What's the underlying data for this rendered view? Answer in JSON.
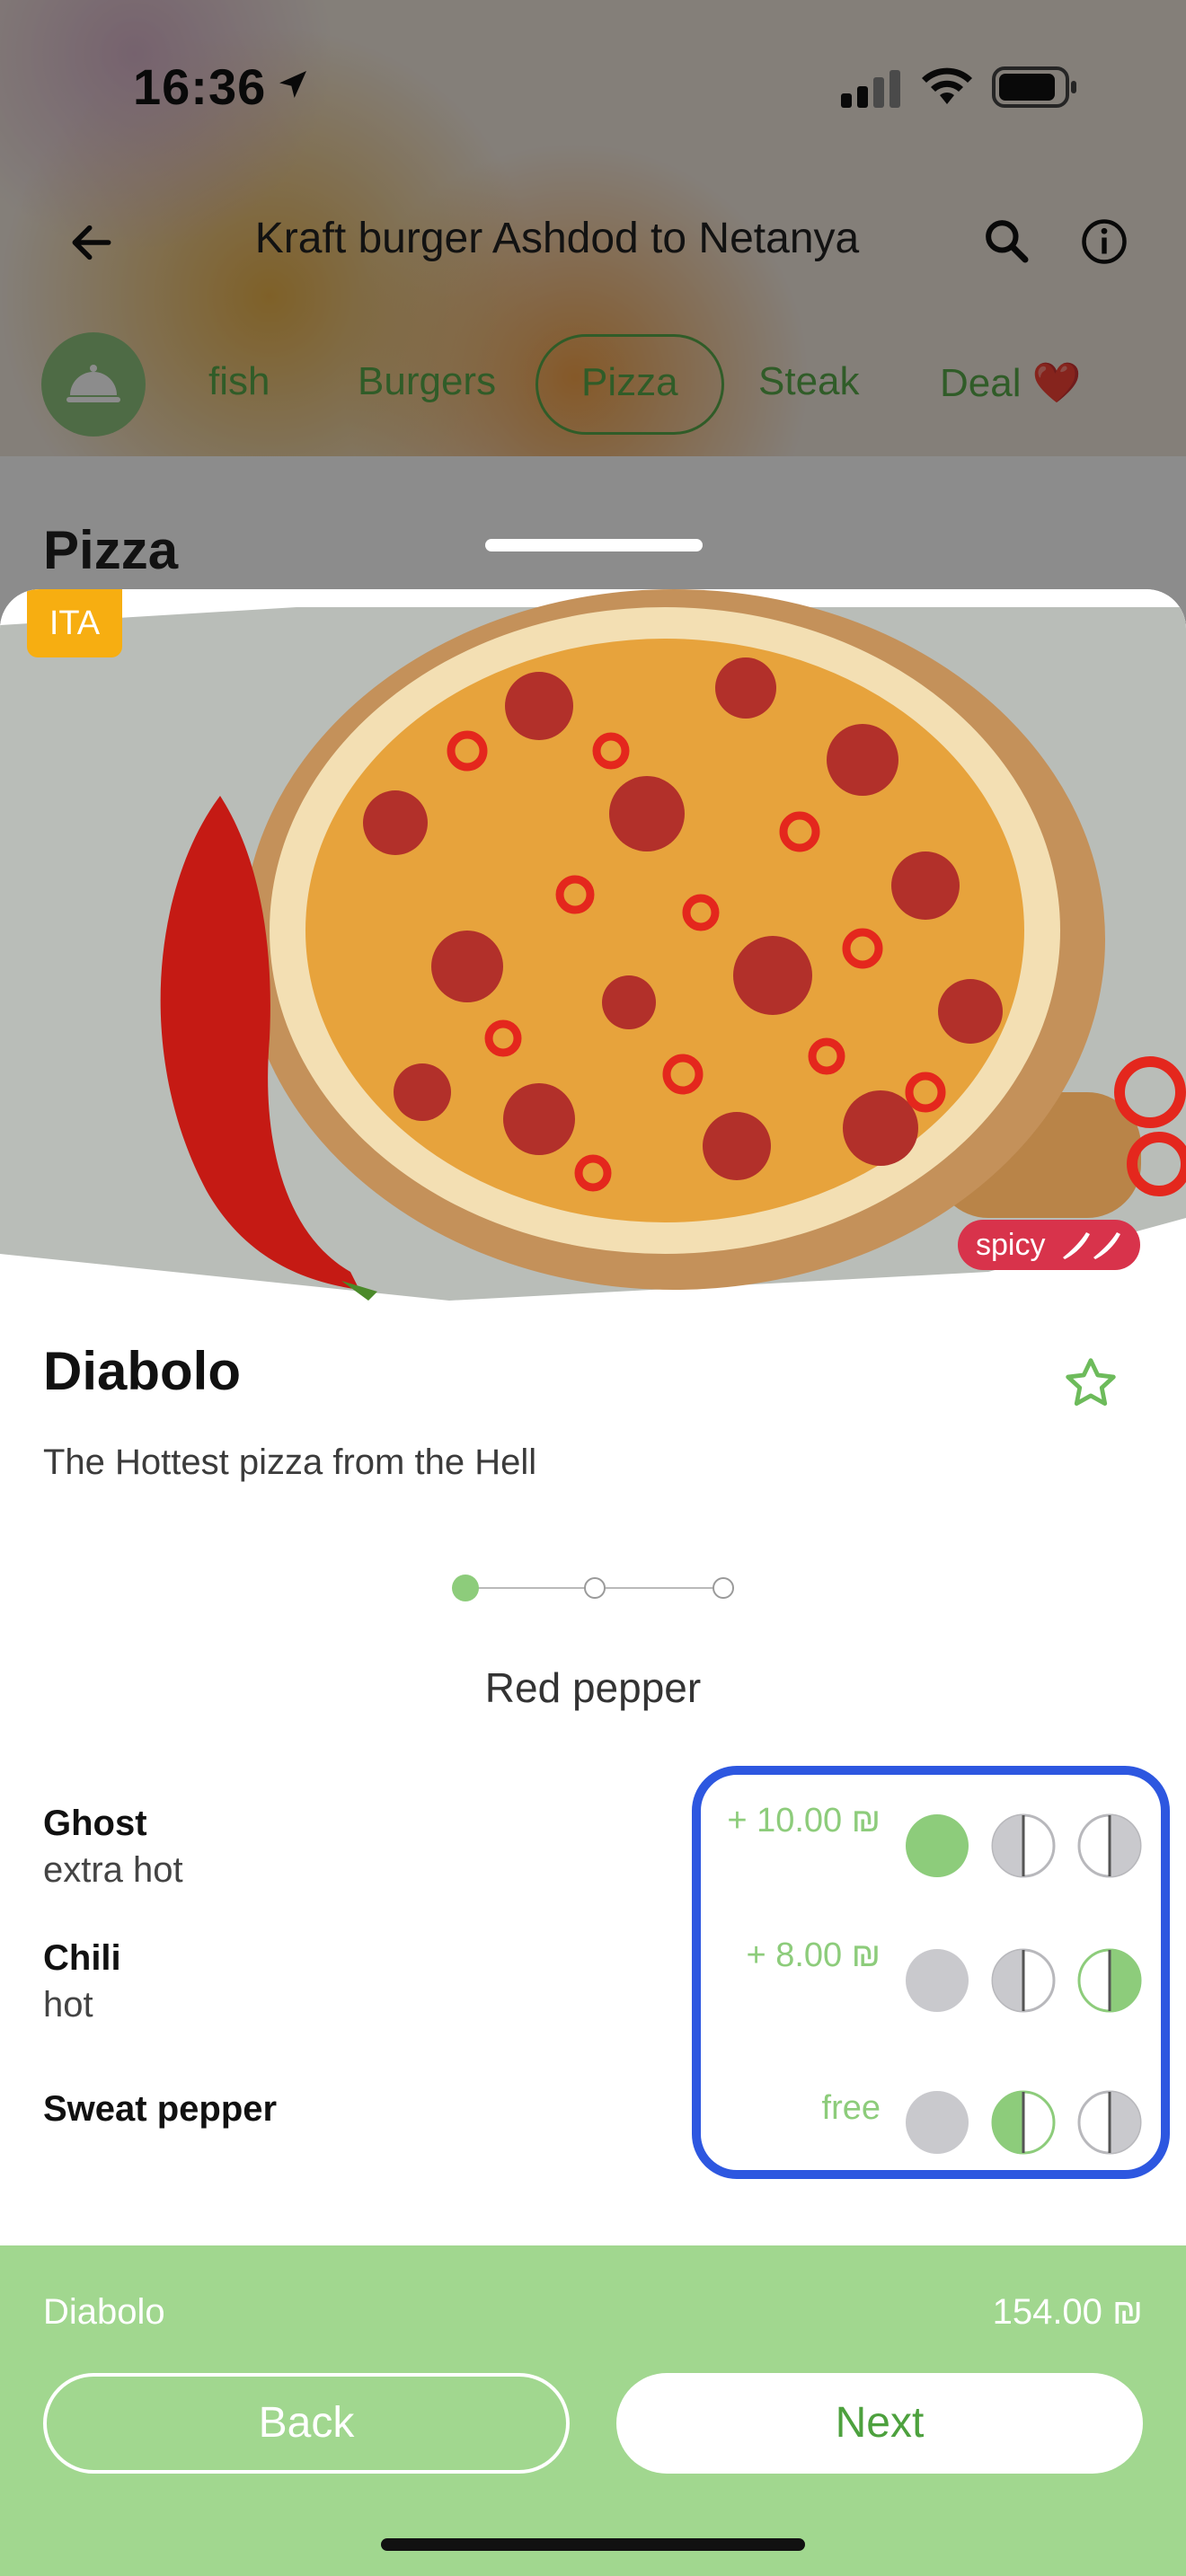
{
  "status_bar": {
    "time": "16:36"
  },
  "app_bar": {
    "title": "Kraft burger Ashdod to Netanya"
  },
  "categories": [
    {
      "label": "fish"
    },
    {
      "label": "Burgers"
    },
    {
      "label": "Pizza",
      "selected": true
    },
    {
      "label": "Steak"
    },
    {
      "label": "Deal ❤️"
    }
  ],
  "section_title": "Pizza",
  "item": {
    "origin_badge": "ITA",
    "spicy_badge": "spicy",
    "name": "Diabolo",
    "description": "The Hottest pizza from the Hell"
  },
  "stepper": {
    "steps": 3,
    "current": 1,
    "title": "Red pepper"
  },
  "options": [
    {
      "name": "Ghost",
      "subtitle": "extra hot",
      "price": "+ 10.00 ₪",
      "selected_choice": "full"
    },
    {
      "name": "Chili",
      "subtitle": "hot",
      "price": "+ 8.00 ₪",
      "selected_choice": "right-half"
    },
    {
      "name": "Sweat pepper",
      "subtitle": "",
      "price": "free",
      "selected_choice": "left-half"
    }
  ],
  "cart": {
    "item_name": "Diabolo",
    "total": "154.00 ₪",
    "back_label": "Back",
    "next_label": "Next"
  },
  "colors": {
    "accent_green": "#8dcc7b",
    "cart_bar": "#a1d78f",
    "spicy_red": "#d8334b",
    "badge_orange": "#f7ae11",
    "highlight_blue": "#2d57e0"
  }
}
